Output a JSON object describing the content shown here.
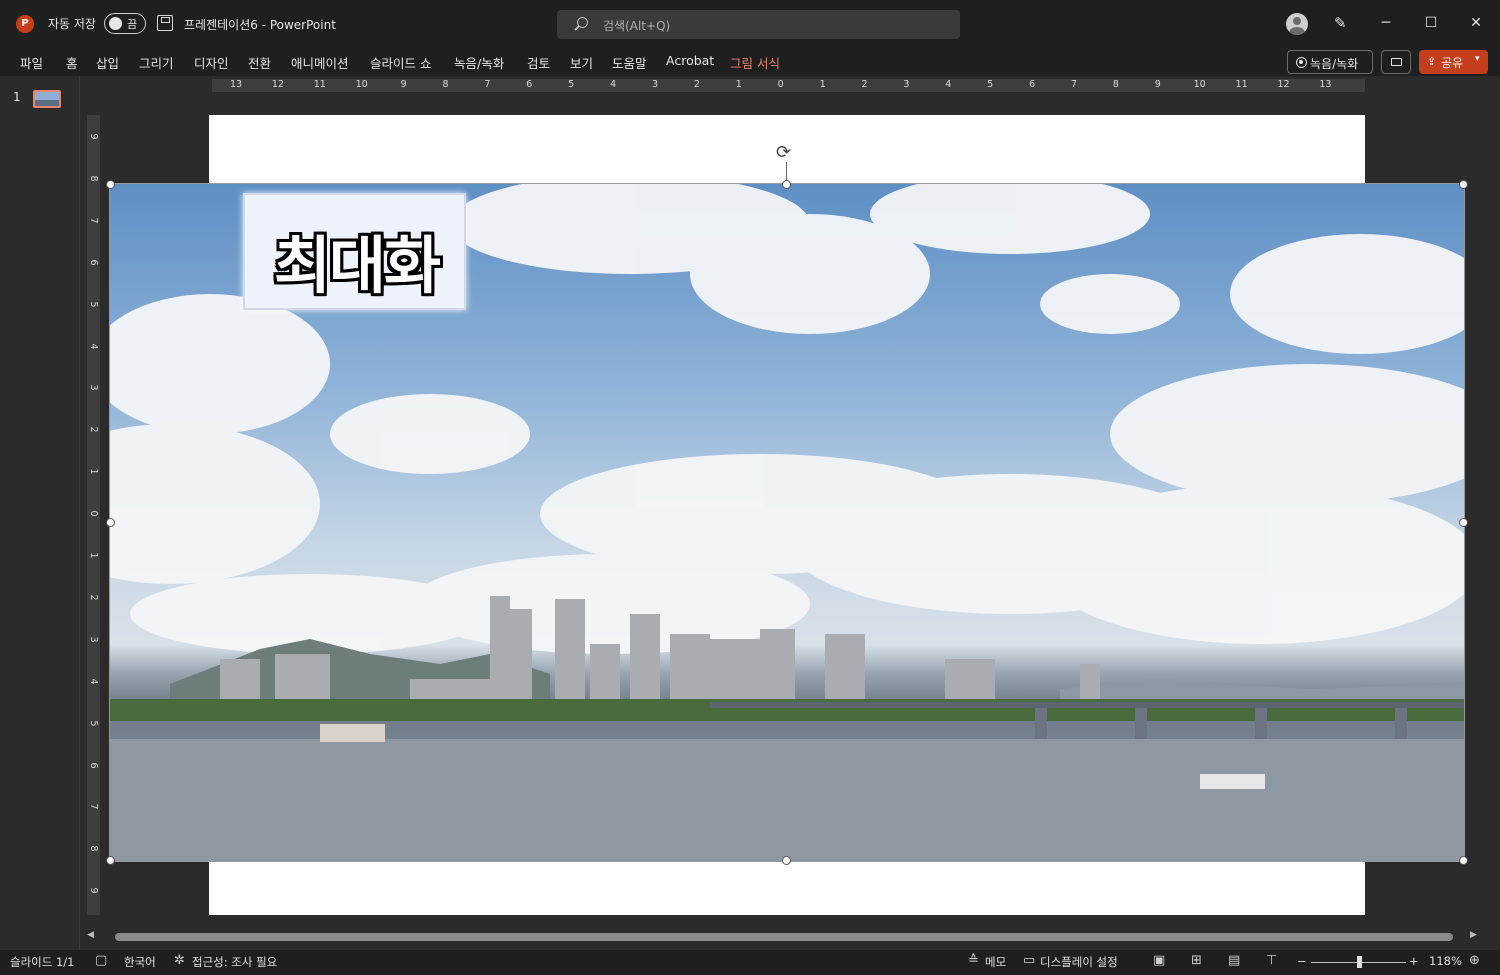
{
  "app": {
    "logo_letter": "P",
    "autosave_label": "자동 저장",
    "autosave_state": "끔",
    "document_title": "프레젠테이션6  -  PowerPoint",
    "search_placeholder": "검색(Alt+Q)",
    "window_controls": {
      "minimize": "─",
      "maximize": "☐",
      "close": "✕"
    }
  },
  "ribbon_tabs": [
    "파일",
    "홈",
    "삽입",
    "그리기",
    "디자인",
    "전환",
    "애니메이션",
    "슬라이드 쇼",
    "녹음/녹화",
    "검토",
    "보기",
    "도움말",
    "Acrobat",
    "그림 서식"
  ],
  "toolbar_right": {
    "record_label": "녹음/녹화",
    "share_label": "공유"
  },
  "slides_pane": {
    "slide_number": "1"
  },
  "ruler": {
    "horizontal": [
      "13",
      "12",
      "11",
      "10",
      "9",
      "8",
      "7",
      "6",
      "5",
      "4",
      "3",
      "2",
      "1",
      "0",
      "1",
      "2",
      "3",
      "4",
      "5",
      "6",
      "7",
      "8",
      "9",
      "10",
      "11",
      "12",
      "13"
    ],
    "vertical": [
      "9",
      "8",
      "7",
      "6",
      "5",
      "4",
      "3",
      "2",
      "1",
      "0",
      "1",
      "2",
      "3",
      "4",
      "5",
      "6",
      "7",
      "8",
      "9"
    ]
  },
  "slide": {
    "label_text": "최대화"
  },
  "status": {
    "slide_position": "슬라이드 1/1",
    "language": "한국어",
    "accessibility": "접근성: 조사 필요",
    "notes_label": "메모",
    "display_settings": "디스플레이 설정",
    "zoom_level": "118%"
  },
  "colors": {
    "accent": "#c43e1c",
    "context_tab": "#e8856a",
    "chrome": "#1f1f1f",
    "canvas": "#2b2b2b"
  }
}
